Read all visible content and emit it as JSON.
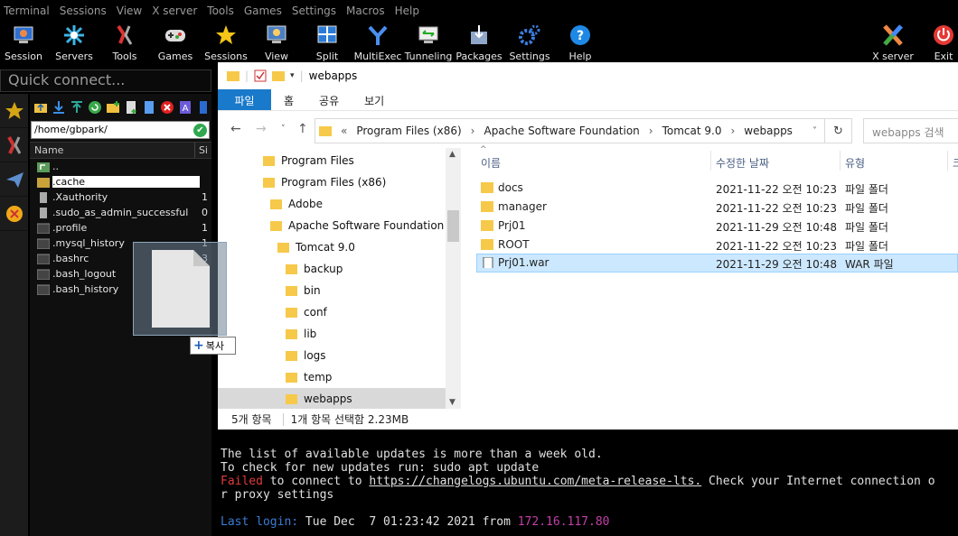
{
  "menu": [
    "Terminal",
    "Sessions",
    "View",
    "X server",
    "Tools",
    "Games",
    "Settings",
    "Macros",
    "Help"
  ],
  "toolbar": {
    "items": [
      {
        "label": "Session",
        "icon": "session-monitor-icon"
      },
      {
        "label": "Servers",
        "icon": "servers-icon"
      },
      {
        "label": "Tools",
        "icon": "tools-icon"
      },
      {
        "label": "Games",
        "icon": "gamepad-icon"
      },
      {
        "label": "Sessions",
        "icon": "star-icon"
      },
      {
        "label": "View",
        "icon": "view-icon"
      },
      {
        "label": "Split",
        "icon": "split-icon"
      },
      {
        "label": "MultiExec",
        "icon": "multiexec-icon"
      },
      {
        "label": "Tunneling",
        "icon": "tunneling-icon"
      },
      {
        "label": "Packages",
        "icon": "packages-icon"
      },
      {
        "label": "Settings",
        "icon": "gear-icon"
      },
      {
        "label": "Help",
        "icon": "help-icon"
      }
    ],
    "xserver_label": "X server",
    "exit_label": "Exit"
  },
  "quick_connect": {
    "placeholder": "Quick connect..."
  },
  "sftp": {
    "path": "/home/gbpark/",
    "columns": {
      "name": "Name",
      "size": "Si"
    },
    "files": [
      {
        "name": "..",
        "size": ""
      },
      {
        "name": ".cache",
        "size": ""
      },
      {
        "name": ".Xauthority",
        "size": "1"
      },
      {
        "name": ".sudo_as_admin_successful",
        "size": "0"
      },
      {
        "name": ".profile",
        "size": "1"
      },
      {
        "name": ".mysql_history",
        "size": "1"
      },
      {
        "name": ".bashrc",
        "size": "3"
      },
      {
        "name": ".bash_logout",
        "size": "2"
      },
      {
        "name": ".bash_history",
        "size": "1"
      }
    ]
  },
  "drag": {
    "copy_label": "복사"
  },
  "explorer": {
    "title": "webapps",
    "ribbon": [
      "파일",
      "홈",
      "공유",
      "보기"
    ],
    "breadcrumb": [
      "Program Files (x86)",
      "Apache Software Foundation",
      "Tomcat 9.0",
      "webapps"
    ],
    "breadcrumb_prefix": "«",
    "search_placeholder": "webapps 검색",
    "tree": [
      "Program Files",
      "Program Files (x86)",
      "Adobe",
      "Apache Software Foundation",
      "Tomcat 9.0",
      "backup",
      "bin",
      "conf",
      "lib",
      "logs",
      "temp",
      "webapps"
    ],
    "columns": {
      "name": "이름",
      "modified": "수정한 날짜",
      "type": "유형",
      "size": "크"
    },
    "files": [
      {
        "name": "docs",
        "modified": "2021-11-22 오전 10:23",
        "type": "파일 폴더"
      },
      {
        "name": "manager",
        "modified": "2021-11-22 오전 10:23",
        "type": "파일 폴더"
      },
      {
        "name": "Prj01",
        "modified": "2021-11-29 오전 10:48",
        "type": "파일 폴더"
      },
      {
        "name": "ROOT",
        "modified": "2021-11-22 오전 10:23",
        "type": "파일 폴더"
      },
      {
        "name": "Prj01.war",
        "modified": "2021-11-29 오전 10:48",
        "type": "WAR 파일"
      }
    ],
    "status": {
      "count": "5개 항목",
      "selection": "1개 항목 선택함 2.23MB"
    }
  },
  "terminal": {
    "line1": "The list of available updates is more than a week old.",
    "line2": "To check for new updates run: sudo apt update",
    "failed": "Failed",
    "line3_mid": " to connect to ",
    "link": "https://changelogs.ubuntu.com/meta-release-lts.",
    "line3_end": " Check your Internet connection o",
    "line4": "r proxy settings",
    "last_login_label": "Last login:",
    "last_login_value": " Tue Dec  7 01:23:42 2021 from ",
    "last_login_ip": "172.16.117.80"
  }
}
